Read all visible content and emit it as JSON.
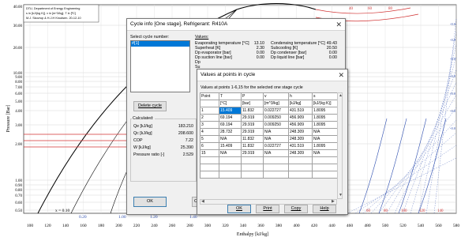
{
  "chart": {
    "header_lines": [
      "DTU, Department of Energy Engineering",
      "s in [kJ/(kg K)]. v in [m^3/kg]. T in [ºC]",
      "M.J. Skovrup & H.J.H Knudsen. 20-12-10"
    ],
    "y_axis_label": "Pressure [Bar]",
    "x_axis_label": "Enthalpy [kJ/kg]",
    "y_ticks": [
      "40.00",
      "30.00",
      "20.00",
      "10.00",
      "9.00",
      "8.00",
      "7.00",
      "6.00",
      "5.00",
      "4.00",
      "3.00",
      "2.00",
      "1.00",
      "0.90",
      "0.80",
      "0.70",
      "0.60",
      "0.50"
    ],
    "x_ticks": [
      "100",
      "120",
      "140",
      "160",
      "180",
      "200",
      "220",
      "240",
      "260",
      "280",
      "300",
      "320",
      "340",
      "360",
      "380",
      "400",
      "420",
      "440",
      "460",
      "480",
      "500",
      "520",
      "540",
      "560",
      "580"
    ],
    "bottom_labels": [
      "x = 0.10",
      "0.20",
      "1.00",
      "1.20",
      "1.40"
    ],
    "right_labels": [
      "-0.0",
      "-0.0",
      "-0.0",
      "-0.0",
      "-0.0",
      "-0.0",
      "-0.0"
    ],
    "top_right_labels": [
      "40",
      "60",
      "80"
    ],
    "bottom_right_labels": [
      "60",
      "80",
      "100",
      "120",
      "140"
    ]
  },
  "cycle_dialog": {
    "title": "Cycle info [One stage], Refrigerant: R410A",
    "select_label": "Select cycle number:",
    "cycle_item": "#[1]",
    "values_header": "Values:",
    "left_values": [
      {
        "label": "Evaporating temperature [°C]",
        "value": "13.10"
      },
      {
        "label": "Superheat [K]",
        "value": "2.30"
      },
      {
        "label": "Dp evaporator [bar]",
        "value": "0.00"
      },
      {
        "label": "Dp suction line [bar]",
        "value": "0.00"
      },
      {
        "label": "Dp",
        "value": ""
      },
      {
        "label": "Su",
        "value": ""
      }
    ],
    "right_values": [
      {
        "label": "Condensing temperature [°C]",
        "value": "49.43"
      },
      {
        "label": "Subcooling [K]",
        "value": "20.50"
      },
      {
        "label": "Dp condenser [bar]",
        "value": "0.00"
      },
      {
        "label": "Dp liquid line [bar]",
        "value": "0.00"
      }
    ],
    "delete_button": "Delete cycle",
    "calculated_header": "Calculated:",
    "calculated": [
      {
        "label": "Qe [kJ/kg]",
        "value": "183.210"
      },
      {
        "label": "Qc [kJ/kg]",
        "value": "208.600"
      },
      {
        "label": "COP",
        "value": "7.22"
      },
      {
        "label": "W [kJ/kg]",
        "value": "25.390"
      },
      {
        "label": "Pressure ratio [-]",
        "value": "2.529"
      }
    ],
    "ok_button": "OK",
    "cancel_button_partial": "C"
  },
  "points_dialog": {
    "title": "Values at points in cycle",
    "subtitle": "Values at points 1-6,15 for the selected one stage cycle",
    "columns": [
      "Point",
      "T",
      "P",
      "v",
      "h",
      "s"
    ],
    "units": [
      "",
      "[°C]",
      "[bar]",
      "[m^3/kg]",
      "[kJ/kg]",
      "[kJ/(kg K)]"
    ],
    "rows": [
      [
        "1",
        "15.409",
        "11.832",
        "0.022727",
        "431.519",
        "1.8095"
      ],
      [
        "2",
        "69.194",
        "29.919",
        "0.009250",
        "456.909",
        "1.8095"
      ],
      [
        "3",
        "69.194",
        "29.919",
        "0.009250",
        "456.909",
        "1.8095"
      ],
      [
        "4",
        "28.732",
        "29.919",
        "N/A",
        "248.309",
        "N/A"
      ],
      [
        "5",
        "N/A",
        "11.832",
        "N/A",
        "248.309",
        "N/A"
      ],
      [
        "6",
        "15.409",
        "11.832",
        "0.022727",
        "431.519",
        "1.8095"
      ],
      [
        "15",
        "N/A",
        "29.919",
        "N/A",
        "248.309",
        "N/A"
      ]
    ],
    "buttons": {
      "ok": "OK",
      "print": "Print",
      "copy": "Copy",
      "help": "Help"
    }
  }
}
